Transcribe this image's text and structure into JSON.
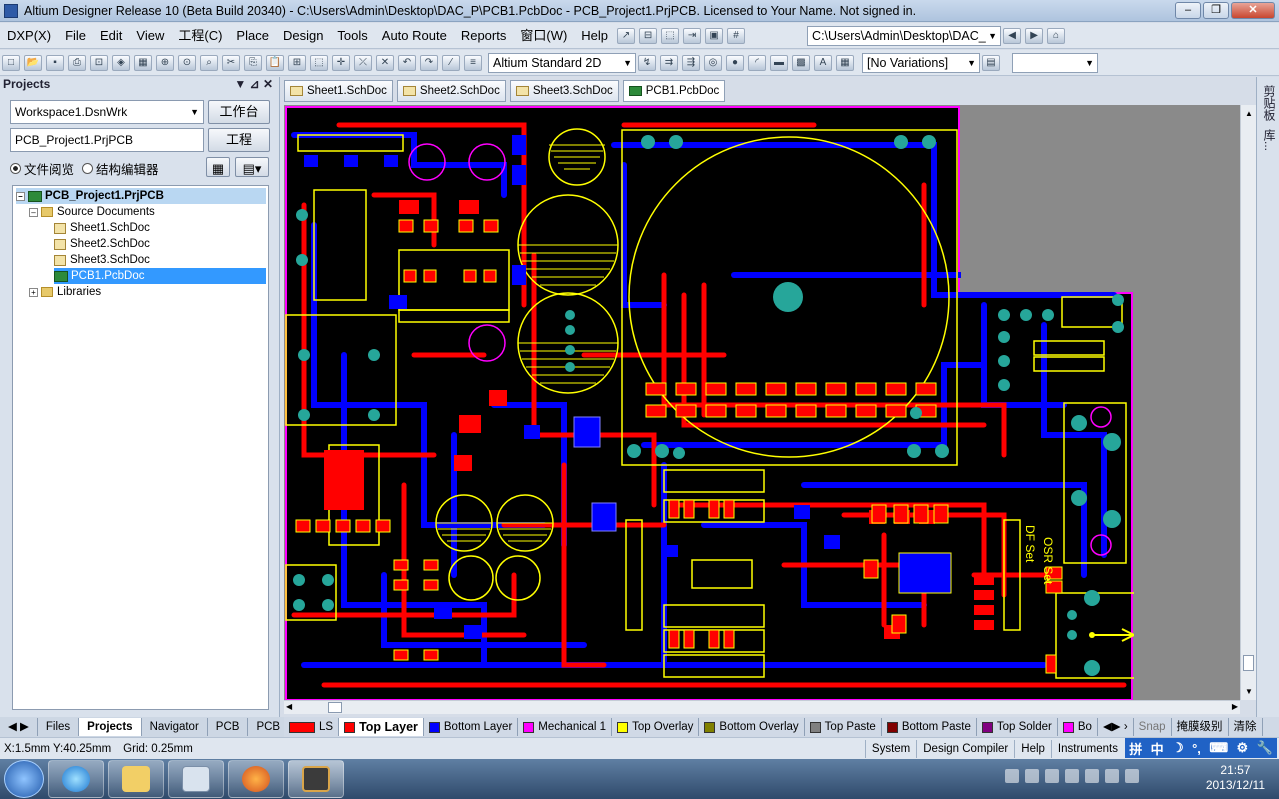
{
  "window": {
    "title": "Altium Designer Release 10 (Beta Build 20340) - C:\\Users\\Admin\\Desktop\\DAC_P\\PCB1.PcbDoc - PCB_Project1.PrjPCB. Licensed to Your Name. Not signed in.",
    "min": "–",
    "max": "❐",
    "close": "✕"
  },
  "menu": [
    "DXP(X)",
    "File",
    "Edit",
    "View",
    "工程(C)",
    "Place",
    "Design",
    "Tools",
    "Auto Route",
    "Reports",
    "窗口(W)",
    "Help"
  ],
  "menu_path_combo": "C:\\Users\\Admin\\Desktop\\DAC_",
  "toolbar": {
    "view_combo": "Altium Standard 2D",
    "variations_combo": "[No Variations]"
  },
  "panel": {
    "title": "Projects",
    "workspace_combo": "Workspace1.DsnWrk",
    "workspace_button": "工作台",
    "project_field": "PCB_Project1.PrjPCB",
    "project_button": "工程",
    "radio_file_view": "文件阅览",
    "radio_struct_editor": "结构编辑器",
    "tree": {
      "project": "PCB_Project1.PrjPCB",
      "source_docs": "Source Documents",
      "docs": [
        "Sheet1.SchDoc",
        "Sheet2.SchDoc",
        "Sheet3.SchDoc",
        "PCB1.PcbDoc"
      ],
      "libraries": "Libraries"
    }
  },
  "doc_tabs": [
    "Sheet1.SchDoc",
    "Sheet2.SchDoc",
    "Sheet3.SchDoc",
    "PCB1.PcbDoc"
  ],
  "right_strip": [
    "剪贴板",
    "库..."
  ],
  "bottom_panel_tabs": [
    "Files",
    "Projects",
    "Navigator",
    "PCB",
    "PCB I"
  ],
  "layer_tabs": [
    {
      "label": "LS",
      "color": "#ff0000"
    },
    {
      "label": "Top Layer",
      "color": "#ff0000"
    },
    {
      "label": "Bottom Layer",
      "color": "#0000ff"
    },
    {
      "label": "Mechanical 1",
      "color": "#ff00ff"
    },
    {
      "label": "Top Overlay",
      "color": "#ffff00"
    },
    {
      "label": "Bottom Overlay",
      "color": "#808000"
    },
    {
      "label": "Top Paste",
      "color": "#808080"
    },
    {
      "label": "Bottom Paste",
      "color": "#800000"
    },
    {
      "label": "Top Solder",
      "color": "#800080"
    },
    {
      "label": "Bo",
      "color": "#ff00ff"
    }
  ],
  "layer_right": {
    "snap": "Snap",
    "mask": "掩膜级别",
    "clear": "清除"
  },
  "status": {
    "coords": "X:1.5mm Y:40.25mm",
    "grid": "Grid: 0.25mm",
    "buttons": [
      "System",
      "Design Compiler",
      "Help",
      "Instruments"
    ]
  },
  "ime": [
    "拼",
    "中",
    "☽",
    "°,",
    "⌨",
    "⚙",
    "🔧"
  ],
  "board_text": {
    "df_set": "DF Set",
    "osr_set": "OSR Set"
  },
  "clock": {
    "time": "21:57",
    "date": "2013/12/11"
  },
  "colors": {
    "top": "#ff0000",
    "bottom": "#0000ff",
    "overlay": "#ffff00",
    "via": "#26a69a",
    "mech": "#ff00ff",
    "board": "#000000"
  }
}
